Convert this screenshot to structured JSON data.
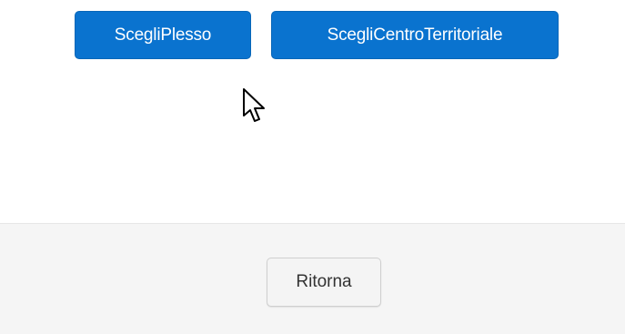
{
  "buttons": {
    "scegli_plesso": "ScegliPlesso",
    "scegli_centro": "ScegliCentroTerritoriale"
  },
  "footer": {
    "ritorna": "Ritorna"
  },
  "colors": {
    "primary": "#0a73cf",
    "footer_bg": "#f5f5f5",
    "default_btn_bg": "#f4f4f4"
  },
  "icons": {
    "cursor": "mouse-pointer-icon"
  }
}
